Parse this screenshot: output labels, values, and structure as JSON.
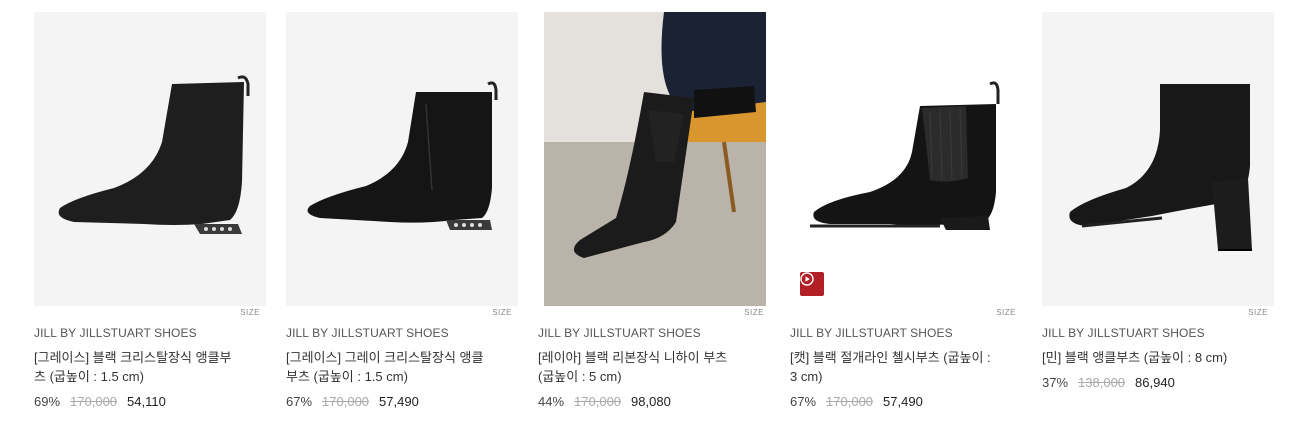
{
  "products": [
    {
      "size_label": "SIZE",
      "brand": "JILL BY JILLSTUART SHOES",
      "name": "[그레이스] 블랙 크리스탈장식 앵클부츠 (굽높이 : 1.5 cm)",
      "discount": "69%",
      "original_price": "170,000",
      "price": "54,110",
      "image_icon": "black-suede-ankle-boot-image",
      "has_video": false
    },
    {
      "size_label": "SIZE",
      "brand": "JILL BY JILLSTUART SHOES",
      "name": "[그레이스] 그레이 크리스탈장식 앵클부츠 (굽높이 : 1.5 cm)",
      "discount": "67%",
      "original_price": "170,000",
      "price": "57,490",
      "image_icon": "black-leather-ankle-boot-image",
      "has_video": false
    },
    {
      "size_label": "SIZE",
      "brand": "JILL BY JILLSTUART SHOES",
      "name": "[레이아] 블랙 리본장식 니하이 부츠 (굽높이 : 5 cm)",
      "discount": "44%",
      "original_price": "170,000",
      "price": "98,080",
      "image_icon": "model-wearing-knee-high-boots-photo",
      "has_video": false
    },
    {
      "size_label": "SIZE",
      "brand": "JILL BY JILLSTUART SHOES",
      "name": "[캣] 블랙 절개라인 첼시부츠 (굽높이 : 3 cm)",
      "discount": "67%",
      "original_price": "170,000",
      "price": "57,490",
      "image_icon": "black-chelsea-boot-image",
      "has_video": true
    },
    {
      "size_label": "SIZE",
      "brand": "JILL BY JILLSTUART SHOES",
      "name": "[민] 블랙 앵클부츠 (굽높이 : 8 cm)",
      "discount": "37%",
      "original_price": "138,000",
      "price": "86,940",
      "image_icon": "black-block-heel-ankle-boot-image",
      "has_video": false
    }
  ],
  "colors": {
    "video_badge": "#b21f24",
    "thumb_bg": "#f4f4f4",
    "strikethrough": "#aaaaaa"
  }
}
